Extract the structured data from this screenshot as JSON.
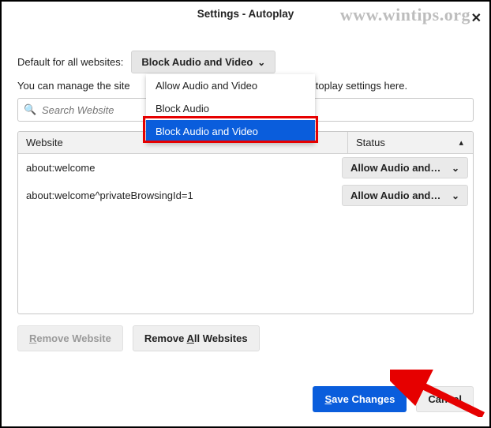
{
  "watermark": "www.wintips.org",
  "title": "Settings - Autoplay",
  "labels": {
    "default_for_all": "Default for all websites:",
    "manage_prefix": "You can manage the site",
    "manage_suffix": "autoplay settings here."
  },
  "dropdown": {
    "selected": "Block Audio and Video",
    "options": {
      "opt0": "Allow Audio and Video",
      "opt1": "Block Audio",
      "opt2": "Block Audio and Video"
    }
  },
  "search": {
    "placeholder": "Search Website"
  },
  "table": {
    "headers": {
      "website": "Website",
      "status": "Status"
    },
    "rows": [
      {
        "website": "about:welcome",
        "status": "Allow Audio and…"
      },
      {
        "website": "about:welcome^privateBrowsingId=1",
        "status": "Allow Audio and…"
      }
    ]
  },
  "buttons": {
    "remove_website": "Remove Website",
    "remove_all": "Remove All Websites",
    "save_changes": "Save Changes",
    "cancel": "Cancel"
  },
  "annotation": {
    "arrow_color": "#e60000",
    "highlight_color": "#e60000"
  }
}
